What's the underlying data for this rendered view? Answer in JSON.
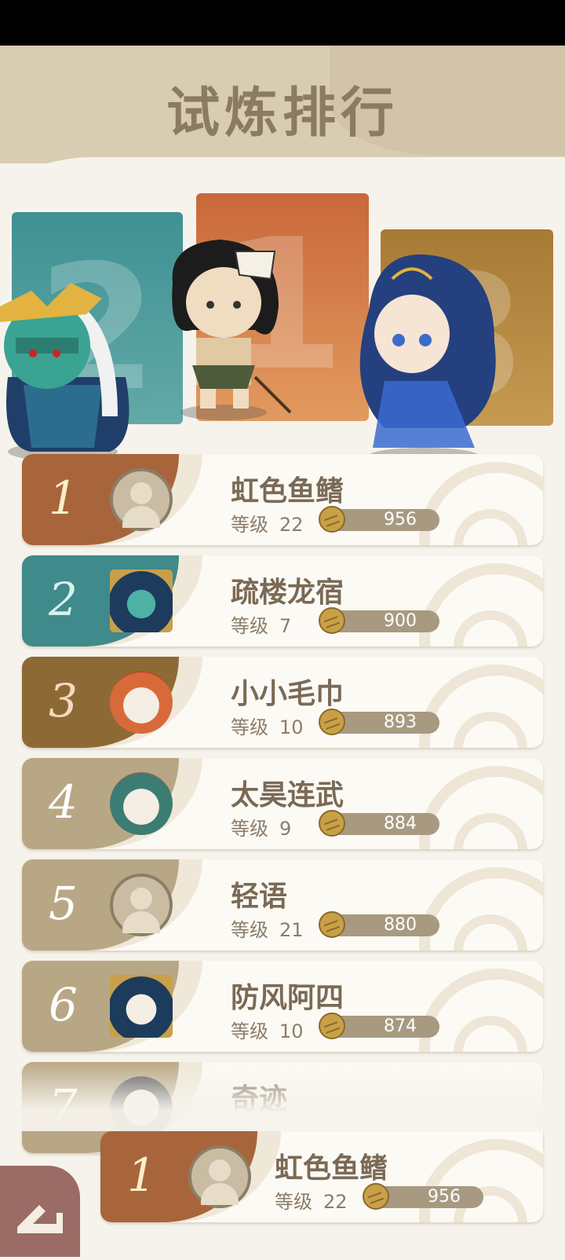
{
  "title": "试炼排行",
  "podium": [
    {
      "rank_label": "2",
      "color": "#4f9e9e"
    },
    {
      "rank_label": "1",
      "color": "#d8824a"
    },
    {
      "rank_label": "3",
      "color": "#b88a45"
    }
  ],
  "level_label": "等级",
  "rows": [
    {
      "rank": "1",
      "name": "虹色鱼鳍",
      "level": "22",
      "score": "956",
      "color": "#a8653c"
    },
    {
      "rank": "2",
      "name": "疏楼龙宿",
      "level": "7",
      "score": "900",
      "color": "#3f8a8a"
    },
    {
      "rank": "3",
      "name": "小小毛巾",
      "level": "10",
      "score": "893",
      "color": "#8d6a35"
    },
    {
      "rank": "4",
      "name": "太昊连武",
      "level": "9",
      "score": "884",
      "color": "#b8a784"
    },
    {
      "rank": "5",
      "name": "轻语",
      "level": "21",
      "score": "880",
      "color": "#b8a784"
    },
    {
      "rank": "6",
      "name": "防风阿四",
      "level": "10",
      "score": "874",
      "color": "#b8a784"
    },
    {
      "rank": "7",
      "name": "奇迹",
      "level": "",
      "score": "",
      "color": "#b8a784"
    }
  ],
  "my_row": {
    "rank": "1",
    "name": "虹色鱼鳍",
    "level": "22",
    "score": "956",
    "color": "#a8653c"
  },
  "icons": {
    "coin": "coin-icon",
    "back": "back-icon"
  }
}
